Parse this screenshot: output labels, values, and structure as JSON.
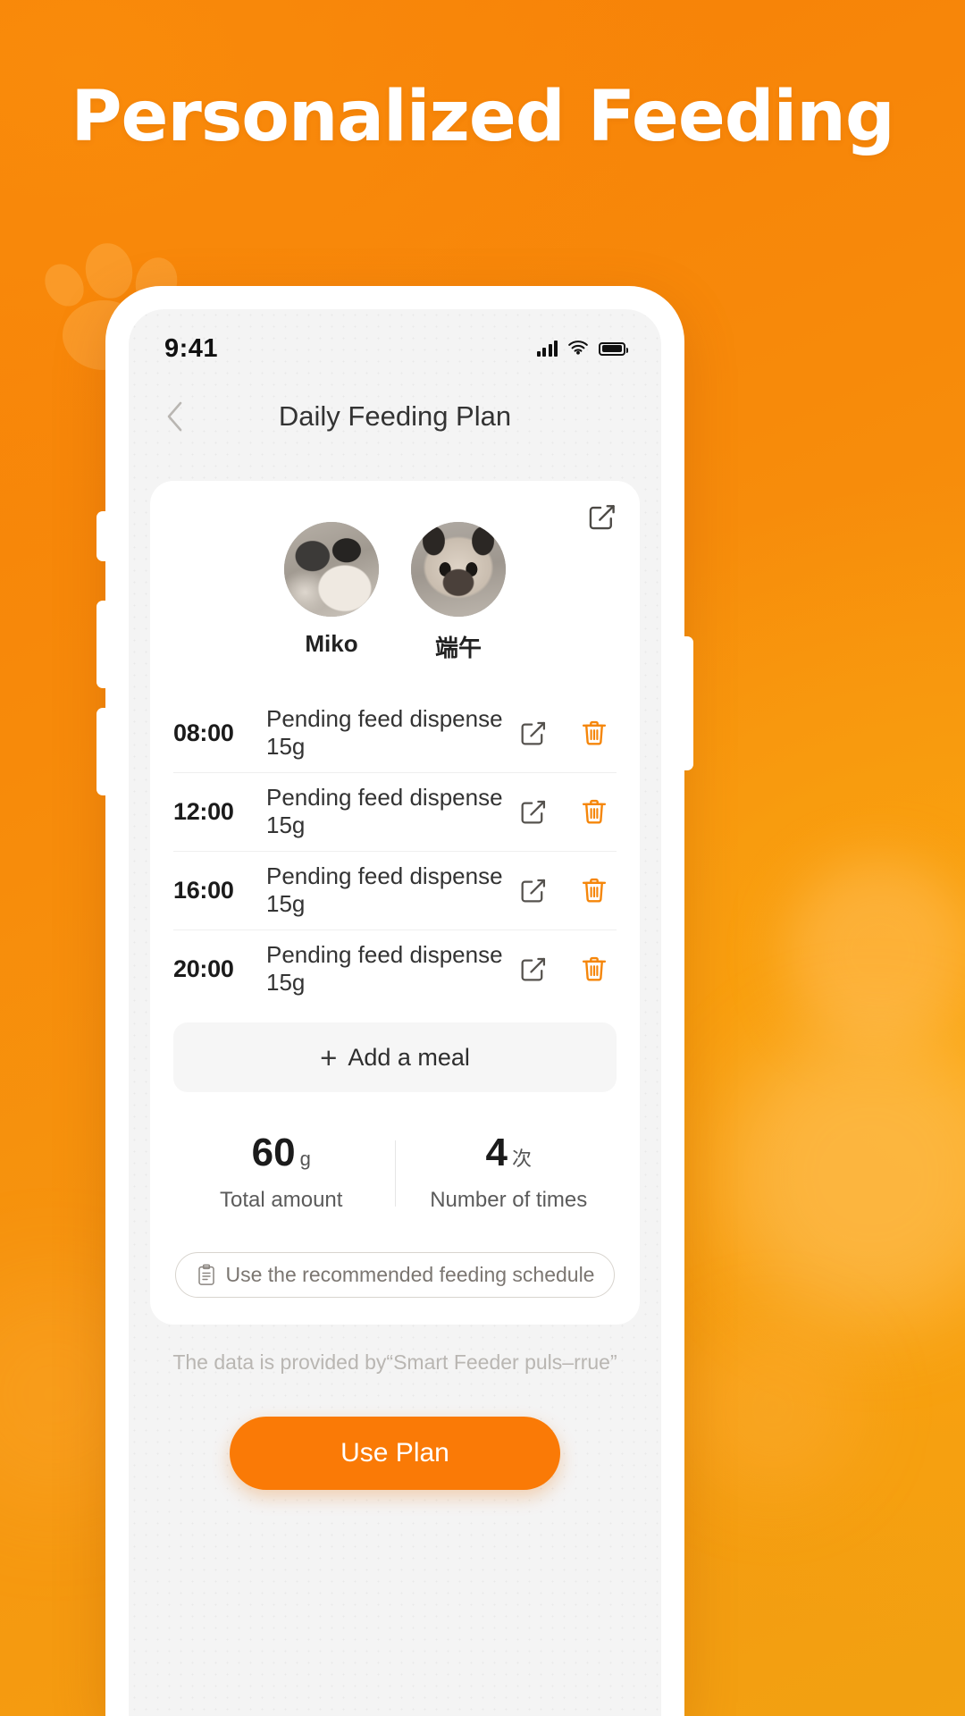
{
  "hero": {
    "title": "Personalized Feeding",
    "accent_color": "#F5860A",
    "title_color": "#FFFFFF"
  },
  "phone": {
    "status_bar": {
      "time": "9:41",
      "signal_icon": "cellular-signal-icon",
      "wifi_icon": "wifi-icon",
      "battery_icon": "battery-icon"
    },
    "nav": {
      "back_icon": "chevron-left-icon",
      "title": "Daily Feeding Plan"
    },
    "card": {
      "edit_icon": "edit-square-icon",
      "pets": [
        {
          "name": "Miko",
          "avatar": "cat-avatar-miko"
        },
        {
          "name": "端午",
          "avatar": "cat-avatar-duanwu"
        }
      ],
      "meals": [
        {
          "time": "08:00",
          "description": "Pending feed dispense 15g",
          "edit_icon": "edit-square-icon",
          "delete_icon": "trash-icon"
        },
        {
          "time": "12:00",
          "description": "Pending feed dispense 15g",
          "edit_icon": "edit-square-icon",
          "delete_icon": "trash-icon"
        },
        {
          "time": "16:00",
          "description": "Pending feed dispense 15g",
          "edit_icon": "edit-square-icon",
          "delete_icon": "trash-icon"
        },
        {
          "time": "20:00",
          "description": "Pending feed dispense 15g",
          "edit_icon": "edit-square-icon",
          "delete_icon": "trash-icon"
        }
      ],
      "add_meal": {
        "plus": "+",
        "label": "Add a meal"
      },
      "stats": [
        {
          "value": "60",
          "unit": "g",
          "label": "Total amount"
        },
        {
          "value": "4",
          "unit": "次",
          "label": "Number of times"
        }
      ],
      "recommended": {
        "icon": "clipboard-icon",
        "label": "Use the recommended feeding schedule"
      }
    },
    "footnote": "The data is provided by“Smart Feeder puls–rrue”",
    "primary_button": {
      "label": "Use Plan",
      "color": "#FA7A06"
    }
  }
}
